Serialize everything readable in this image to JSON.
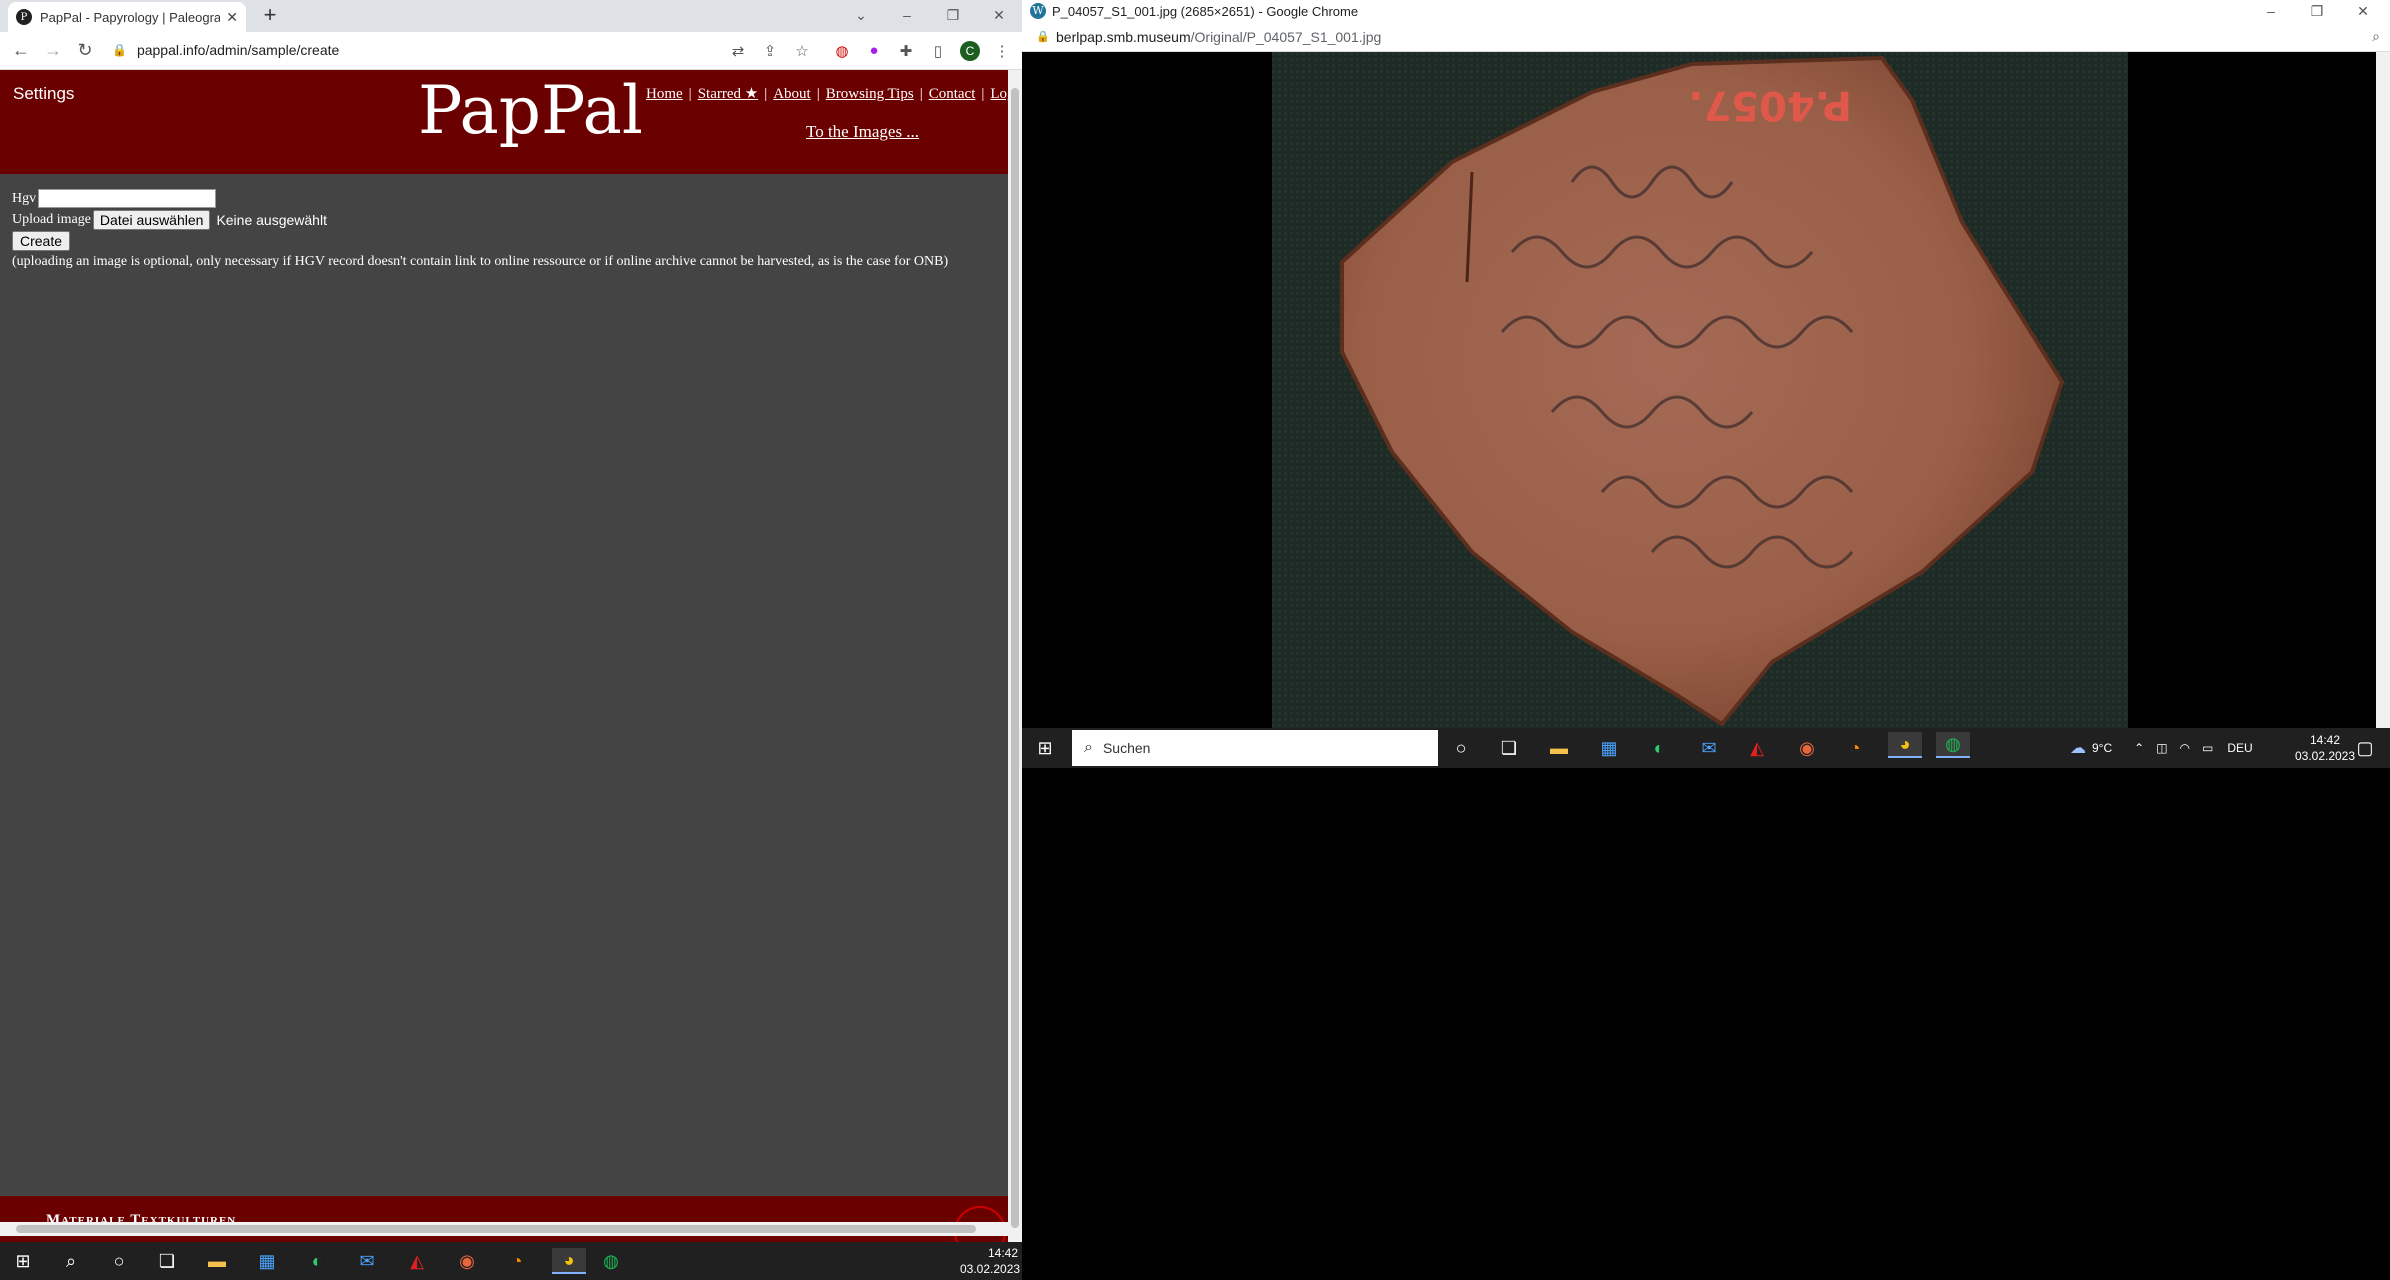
{
  "left_window": {
    "tab_title": "PapPal - Papyrology | Paleograph",
    "tab_favicon": "P",
    "url": "pappal.info/admin/sample/create",
    "avatar_letter": "C"
  },
  "page": {
    "settings_label": "Settings",
    "logo": "PapPal",
    "nav": {
      "home": "Home",
      "starred": "Starred ★",
      "about": "About",
      "browsing_tips": "Browsing Tips",
      "contact": "Contact",
      "logout": "Logout",
      "separator": "|"
    },
    "to_images": "To the Images ...",
    "form": {
      "hgv_label": "Hgv",
      "hgv_value": "",
      "upload_label": "Upload image",
      "file_button": "Datei auswählen",
      "file_status": "Keine ausgewählt",
      "create_button": "Create",
      "note": "(uploading an image is optional, only necessary if HGV record doesn't contain link to online ressource or if online archive cannot be harvested, as is the case for ONB)"
    },
    "footer_text": "Materiale Textkulturen",
    "header_color": "#6b0000",
    "page_bg": "#444444"
  },
  "left_taskbar": {
    "time": "14:42",
    "date": "03.02.2023"
  },
  "right_window": {
    "title": "P_04057_S1_001.jpg (2685×2651) - Google Chrome",
    "favicon": "W",
    "url_host": "berlpap.smb.museum",
    "url_path": "/Original/P_04057_S1_001.jpg",
    "image_inscription": "P.4057.",
    "image_subject": "ostracon-fragment"
  },
  "right_taskbar": {
    "search_placeholder": "Suchen",
    "weather": "9°C",
    "language": "DEU",
    "time": "14:42",
    "date": "03.02.2023"
  }
}
